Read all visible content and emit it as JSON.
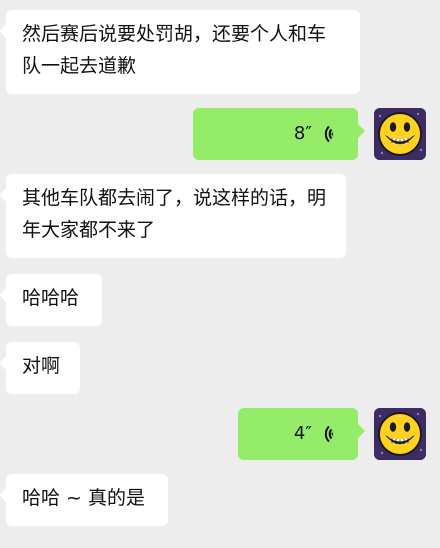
{
  "messages": [
    {
      "direction": "incoming",
      "type": "text",
      "text": "然后赛后说要处罚胡，还要个人和车队一起去道歉"
    },
    {
      "direction": "outgoing",
      "type": "voice",
      "duration": "8″",
      "avatar_icon": "smiley-face-avatar"
    },
    {
      "direction": "incoming",
      "type": "text",
      "text": "其他车队都去闹了，说这样的话，明年大家都不来了"
    },
    {
      "direction": "incoming",
      "type": "text",
      "text": "哈哈哈"
    },
    {
      "direction": "incoming",
      "type": "text",
      "text": "对啊"
    },
    {
      "direction": "outgoing",
      "type": "voice",
      "duration": "4″",
      "avatar_icon": "smiley-face-avatar"
    },
    {
      "direction": "incoming",
      "type": "text",
      "text": "哈哈 ~ 真的是"
    }
  ],
  "colors": {
    "background": "#ededed",
    "incoming_bubble": "#ffffff",
    "outgoing_bubble": "#95ec69",
    "text": "#111111"
  },
  "icons": {
    "voice": "voice-wave-icon",
    "avatar": "smiley-face-icon"
  }
}
